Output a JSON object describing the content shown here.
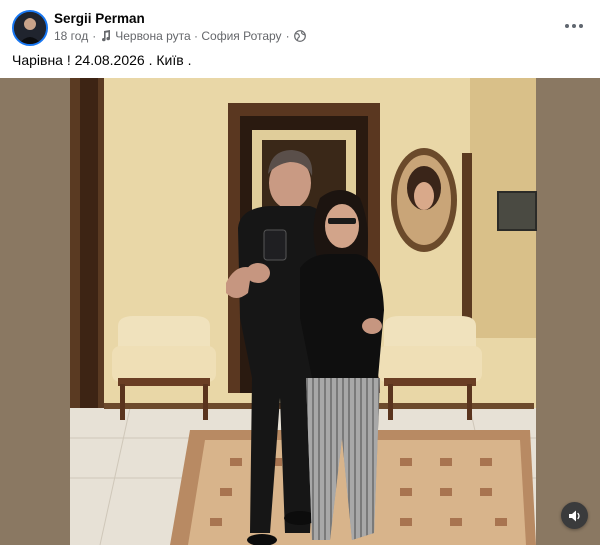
{
  "post": {
    "author": "Sergii Perman",
    "time": "18 год",
    "separator": "·",
    "music": "Червона рута · София Ротару",
    "caption": "Чарівна ! 24.08.2026 . Київ ."
  },
  "icons": {
    "more": "more-horizontal-icon",
    "music": "music-note-icon",
    "audience": "globe-icon",
    "sound": "speaker-icon"
  },
  "colors": {
    "accent": "#1877f2",
    "meta_text": "#65676b",
    "wall": "#e8d6a6",
    "side_bars": "#8a7862"
  }
}
